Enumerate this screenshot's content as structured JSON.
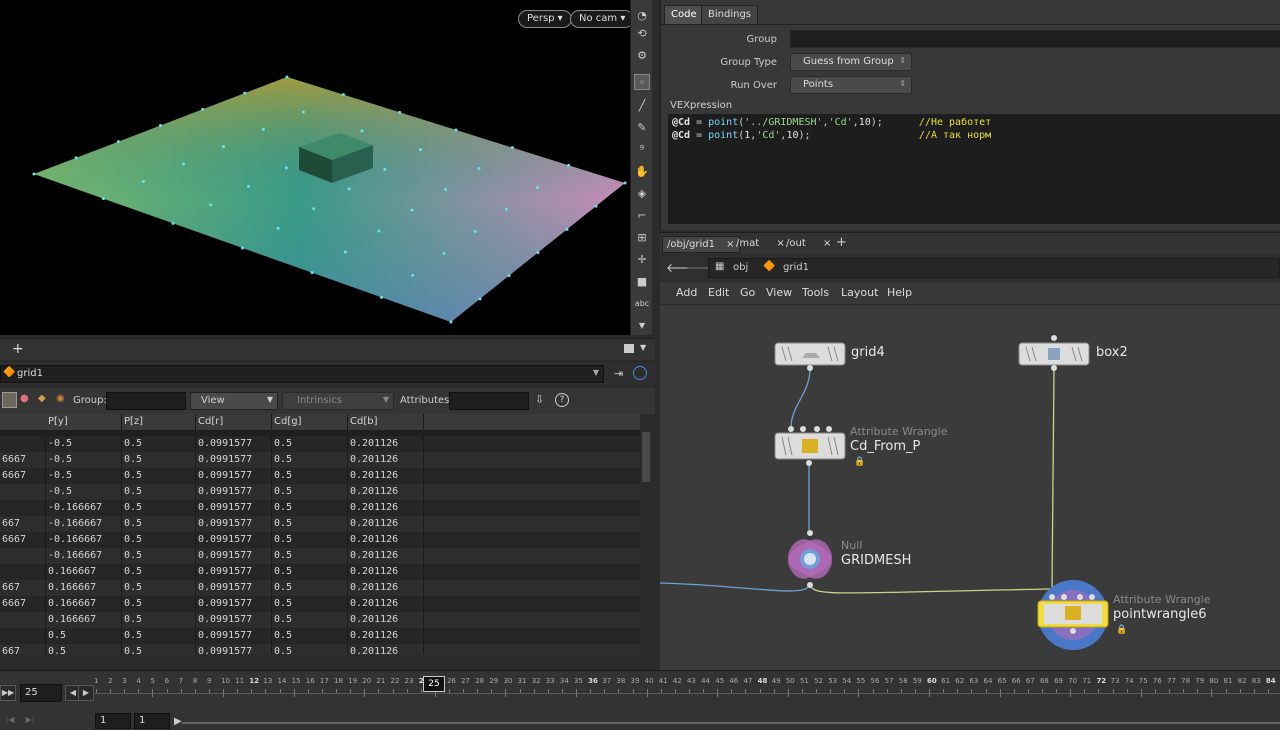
{
  "viewport": {
    "persp_label": "Persp ▾",
    "cam_label": "No cam ▾"
  },
  "spreadsheet": {
    "add_tab": "+",
    "node_path": "grid1",
    "group_label": "Group:",
    "view_label": "View",
    "intrinsics_label": "Intrinsics",
    "attributes_label": "Attributes:",
    "headers": [
      "P[y]",
      "P[z]",
      "Cd[r]",
      "Cd[g]",
      "Cd[b]"
    ],
    "rows": [
      {
        "px": "",
        "py": "-0.5",
        "pz": "0.5",
        "r": "0.0991577",
        "g": "0.5",
        "b": "0.201126"
      },
      {
        "px": "6667",
        "py": "-0.5",
        "pz": "0.5",
        "r": "0.0991577",
        "g": "0.5",
        "b": "0.201126"
      },
      {
        "px": "6667",
        "py": "-0.5",
        "pz": "0.5",
        "r": "0.0991577",
        "g": "0.5",
        "b": "0.201126"
      },
      {
        "px": "",
        "py": "-0.5",
        "pz": "0.5",
        "r": "0.0991577",
        "g": "0.5",
        "b": "0.201126"
      },
      {
        "px": "",
        "py": "-0.166667",
        "pz": "0.5",
        "r": "0.0991577",
        "g": "0.5",
        "b": "0.201126"
      },
      {
        "px": "667",
        "py": "-0.166667",
        "pz": "0.5",
        "r": "0.0991577",
        "g": "0.5",
        "b": "0.201126"
      },
      {
        "px": "6667",
        "py": "-0.166667",
        "pz": "0.5",
        "r": "0.0991577",
        "g": "0.5",
        "b": "0.201126"
      },
      {
        "px": "",
        "py": "-0.166667",
        "pz": "0.5",
        "r": "0.0991577",
        "g": "0.5",
        "b": "0.201126"
      },
      {
        "px": "",
        "py": "0.166667",
        "pz": "0.5",
        "r": "0.0991577",
        "g": "0.5",
        "b": "0.201126"
      },
      {
        "px": "667",
        "py": "0.166667",
        "pz": "0.5",
        "r": "0.0991577",
        "g": "0.5",
        "b": "0.201126"
      },
      {
        "px": "6667",
        "py": "0.166667",
        "pz": "0.5",
        "r": "0.0991577",
        "g": "0.5",
        "b": "0.201126"
      },
      {
        "px": "",
        "py": "0.166667",
        "pz": "0.5",
        "r": "0.0991577",
        "g": "0.5",
        "b": "0.201126"
      },
      {
        "px": "",
        "py": "0.5",
        "pz": "0.5",
        "r": "0.0991577",
        "g": "0.5",
        "b": "0.201126"
      },
      {
        "px": "667",
        "py": "0.5",
        "pz": "0.5",
        "r": "0.0991577",
        "g": "0.5",
        "b": "0.201126"
      }
    ]
  },
  "code_panel": {
    "tabs": [
      "Code",
      "Bindings"
    ],
    "group_label": "Group",
    "group_type_label": "Group Type",
    "group_type_value": "Guess from Group",
    "run_over_label": "Run Over",
    "run_over_value": "Points",
    "vex_label": "VEXpression",
    "line1": {
      "var": "@Cd",
      "op": " = ",
      "fn": "point",
      "open": "(",
      "str": "'../GRIDMESH'",
      "sep1": ",",
      "str2": "'Cd'",
      "sep2": ",",
      "num": "10",
      "close": ");",
      "pad": "      ",
      "cmt": "//Не работет"
    },
    "line2": {
      "var": "@Cd",
      "op": " = ",
      "fn": "point",
      "open": "(",
      "num1": "1",
      "sep1": ",",
      "str": "'Cd'",
      "sep2": ",",
      "num": "10",
      "close": ");",
      "pad": "                  ",
      "cmt": "//А так норм"
    }
  },
  "network": {
    "tabs": [
      "/obj/grid1",
      "/mat",
      "/out"
    ],
    "tab_close": "×",
    "add_tab": "+",
    "path_obj": "obj",
    "path_node": "grid1",
    "menu": [
      "Add",
      "Edit",
      "Go",
      "View",
      "Tools",
      "Layout",
      "Help"
    ],
    "nodes": {
      "grid4": {
        "label": "grid4"
      },
      "box2": {
        "label": "box2"
      },
      "cd_from_p": {
        "type": "Attribute Wrangle",
        "label": "Cd_From_P"
      },
      "gridmesh": {
        "type": "Null",
        "label": "GRIDMESH"
      },
      "pointwrangle6": {
        "type": "Attribute Wrangle",
        "label": "pointwrangle6"
      }
    }
  },
  "timeline": {
    "current_frame": "25",
    "frame_marker": "25",
    "start_field": "1",
    "end_field": "1",
    "ticks": [
      "1",
      "2",
      "3",
      "4",
      "5",
      "6",
      "7",
      "8",
      "9",
      "10",
      "11",
      "12",
      "13",
      "14",
      "15",
      "16",
      "17",
      "18",
      "19",
      "20",
      "21",
      "22",
      "23",
      "24",
      "25",
      "26",
      "27",
      "28",
      "29",
      "30",
      "31",
      "32",
      "33",
      "34",
      "35",
      "36",
      "37",
      "38",
      "39",
      "40",
      "41",
      "42",
      "43",
      "44",
      "45",
      "46",
      "47",
      "48",
      "49",
      "50",
      "51",
      "52",
      "53",
      "54",
      "55",
      "56",
      "57",
      "58",
      "59",
      "60",
      "61",
      "62",
      "63",
      "64",
      "65",
      "66",
      "67",
      "68",
      "69",
      "70",
      "71",
      "72",
      "73",
      "74",
      "75",
      "76",
      "77",
      "78",
      "79",
      "80",
      "81",
      "82",
      "83",
      "84"
    ]
  },
  "colors": {
    "wire_blue": "#6f9fd8",
    "wire_yellow": "#c9d48a",
    "display_flag": "#4a78c8",
    "template_flag": "#b46ab8"
  }
}
